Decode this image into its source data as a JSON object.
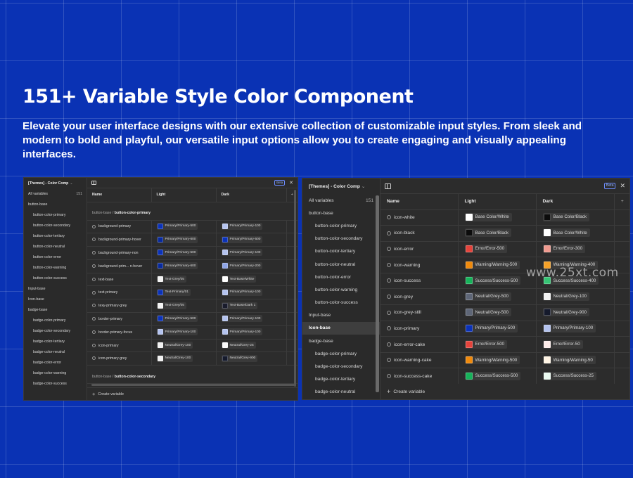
{
  "hero": {
    "title": "151+ Variable Style Color Component",
    "description": "Elevate your user interface designs with our extensive collection of customizable input styles. From sleek and modern to bold and playful, our versatile input options allow you to create engaging and visually appealing interfaces."
  },
  "watermark": "www.25xt.com",
  "left_panel": {
    "collection": "[Themes] - Color Comp",
    "beta": "Beta",
    "all_variables": "All variables",
    "count": "151",
    "sidebar": [
      {
        "label": "button-base",
        "child": false
      },
      {
        "label": "button-color-primary",
        "child": true
      },
      {
        "label": "button-color-secondary",
        "child": true
      },
      {
        "label": "button-color-tertiary",
        "child": true
      },
      {
        "label": "button-color-neutral",
        "child": true
      },
      {
        "label": "button-color-error",
        "child": true
      },
      {
        "label": "button-color-warning",
        "child": true
      },
      {
        "label": "button-color-success",
        "child": true
      },
      {
        "label": "Input-base",
        "child": false
      },
      {
        "label": "Icon-base",
        "child": false
      },
      {
        "label": "badge-base",
        "child": false
      },
      {
        "label": "badge-color-primary",
        "child": true
      },
      {
        "label": "badge-color-secondary",
        "child": true
      },
      {
        "label": "badge-color-tertiary",
        "child": true
      },
      {
        "label": "badge-color-neutral",
        "child": true
      },
      {
        "label": "badge-color-error",
        "child": true
      },
      {
        "label": "badge-color-warning",
        "child": true
      },
      {
        "label": "badge-color-success",
        "child": true
      }
    ],
    "columns": {
      "name": "Name",
      "light": "Light",
      "dark": "Dark",
      "add": "+"
    },
    "group1": {
      "path": "button-base / ",
      "name": "button-color-primary"
    },
    "rows": [
      {
        "name": "background-primary",
        "light": "Primary/Primary-500",
        "light_color": "#0b32b8",
        "dark": "Primary/Primary-100",
        "dark_color": "#b4c3ef"
      },
      {
        "name": "background-primary-hover",
        "light": "Primary/Primary-600",
        "light_color": "#082a9c",
        "dark": "Primary/Primary-500",
        "dark_color": "#0b32b8"
      },
      {
        "name": "background-primary-non",
        "light": "Primary/Primary-500",
        "light_color": "#0b32b8",
        "dark": "Primary/Primary-100",
        "dark_color": "#b4c3ef"
      },
      {
        "name": "background-prim... n-hover",
        "light": "Primary/Primary-600",
        "light_color": "#082a9c",
        "dark": "Primary/Primary-200",
        "dark_color": "#8ea4e6"
      },
      {
        "name": "text-base",
        "light": "Text-Grey/05",
        "light_color": "#f4f4f4",
        "dark": "Text-Base/White",
        "dark_color": "#ffffff"
      },
      {
        "name": "text-primary",
        "light": "Text-Primary/01",
        "light_color": "#0b32b8",
        "dark": "Primary/Primary-100",
        "dark_color": "#b4c3ef"
      },
      {
        "name": "texy-primary-grey",
        "light": "Text-Grey/05",
        "light_color": "#f4f4f4",
        "dark": "Text-Base/Dark 1",
        "dark_color": "#1a1c2c"
      },
      {
        "name": "border-primary",
        "light": "Primary/Primary-500",
        "light_color": "#0b32b8",
        "dark": "Primary/Primary-100",
        "dark_color": "#b4c3ef"
      },
      {
        "name": "border-primary-focus",
        "light": "Primary/Primary-100",
        "light_color": "#b4c3ef",
        "dark": "Primary/Primary-100",
        "dark_color": "#b4c3ef"
      },
      {
        "name": "icon-primary",
        "light": "Neutral/Grey-100",
        "light_color": "#f1f1f1",
        "dark": "Neutral/Grey-25",
        "dark_color": "#fafafa"
      },
      {
        "name": "icon-primary-grey",
        "light": "Neutral/Grey-100",
        "light_color": "#f1f1f1",
        "dark": "Neutral/Grey-900",
        "dark_color": "#151a2c"
      }
    ],
    "group2": {
      "path": "button-base / ",
      "name": "button-color-secondary"
    },
    "footer": "Create variable"
  },
  "right_panel": {
    "collection": "[Themes] - Color Comp",
    "beta": "Beta",
    "all_variables": "All variables",
    "count": "151",
    "sidebar": [
      {
        "label": "button-base",
        "child": false,
        "active": false
      },
      {
        "label": "button-color-primary",
        "child": true,
        "active": false
      },
      {
        "label": "button-color-secondary",
        "child": true,
        "active": false
      },
      {
        "label": "button-color-tertiary",
        "child": true,
        "active": false
      },
      {
        "label": "button-color-neutral",
        "child": true,
        "active": false
      },
      {
        "label": "button-color-error",
        "child": true,
        "active": false
      },
      {
        "label": "button-color-warning",
        "child": true,
        "active": false
      },
      {
        "label": "button-color-success",
        "child": true,
        "active": false
      },
      {
        "label": "Input-base",
        "child": false,
        "active": false
      },
      {
        "label": "Icon-base",
        "child": false,
        "active": true
      },
      {
        "label": "badge-base",
        "child": false,
        "active": false
      },
      {
        "label": "badge-color-primary",
        "child": true,
        "active": false
      },
      {
        "label": "badge-color-secondary",
        "child": true,
        "active": false
      },
      {
        "label": "badge-color-tertiary",
        "child": true,
        "active": false
      },
      {
        "label": "badge-color-neutral",
        "child": true,
        "active": false
      }
    ],
    "columns": {
      "name": "Name",
      "light": "Light",
      "dark": "Dark",
      "add": "+"
    },
    "rows": [
      {
        "name": "icon-white",
        "light": "Base Color/White",
        "light_color": "#ffffff",
        "dark": "Base Color/Black",
        "dark_color": "#0c0c0c"
      },
      {
        "name": "icon-black",
        "light": "Base Color/Black",
        "light_color": "#0c0c0c",
        "dark": "Base Color/White",
        "dark_color": "#ffffff"
      },
      {
        "name": "icon-error",
        "light": "Error/Error-500",
        "light_color": "#e5433b",
        "dark": "Error/Error-300",
        "dark_color": "#f09a8f"
      },
      {
        "name": "icon-warning",
        "light": "Warning/Warning-500",
        "light_color": "#f08a0c",
        "dark": "Warning/Warning-400",
        "dark_color": "#f5a128"
      },
      {
        "name": "icon-success",
        "light": "Success/Success-500",
        "light_color": "#16b35a",
        "dark": "Success/Success-400",
        "dark_color": "#36c374"
      },
      {
        "name": "icon-grey",
        "light": "Neutral/Grey-500",
        "light_color": "#5e6677",
        "dark": "Neutral/Grey-100",
        "dark_color": "#f1f1f1"
      },
      {
        "name": "icon-grey-still",
        "light": "Neutral/Grey-500",
        "light_color": "#5e6677",
        "dark": "Neutral/Grey-900",
        "dark_color": "#151a2c"
      },
      {
        "name": "icon-primary",
        "light": "Primary/Primary-500",
        "light_color": "#0b32b8",
        "dark": "Primary/Primary-100",
        "dark_color": "#b4c3ef"
      },
      {
        "name": "icon-error-cake",
        "light": "Error/Error-500",
        "light_color": "#e5433b",
        "dark": "Error/Error-50",
        "dark_color": "#fdecea"
      },
      {
        "name": "icon-warning-cake",
        "light": "Warning/Warning-500",
        "light_color": "#f08a0c",
        "dark": "Warning/Warning-50",
        "dark_color": "#fff4e4"
      },
      {
        "name": "icon-success-cake",
        "light": "Success/Success-500",
        "light_color": "#16b35a",
        "dark": "Success/Success-25",
        "dark_color": "#eafaf0"
      }
    ],
    "footer": "Create variable"
  }
}
